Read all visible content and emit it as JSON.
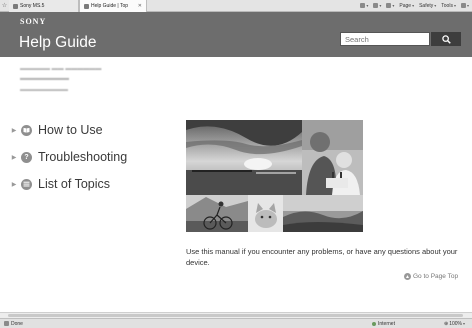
{
  "browser": {
    "tabs": [
      {
        "label": "Sony MS.5",
        "active": false
      },
      {
        "label": "Help Guide | Top",
        "active": true
      }
    ],
    "command_bar": {
      "page_label": "Page",
      "safety_label": "Safety",
      "tools_label": "Tools"
    }
  },
  "header": {
    "brand": "SONY",
    "title": "Help Guide",
    "search": {
      "placeholder": "Search",
      "value": ""
    }
  },
  "nav": {
    "items": [
      {
        "label": "How to Use",
        "icon": "book-icon"
      },
      {
        "label": "Troubleshooting",
        "icon": "question-icon"
      },
      {
        "label": "List of Topics",
        "icon": "list-icon"
      }
    ]
  },
  "intro": {
    "message": "Use this manual if you encounter any problems, or have any questions about your device.",
    "page_top_link": "Go to Page Top"
  },
  "status_bar": {
    "left_text": "Done",
    "zone_text": "Internet",
    "zoom": "100%"
  },
  "colors": {
    "header_bg": "#6d6d6d",
    "search_button_bg": "#3d3d3d",
    "nav_icon_bg": "#8f8f8f"
  }
}
